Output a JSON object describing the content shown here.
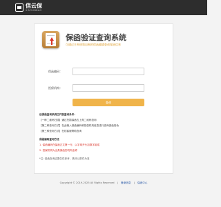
{
  "header": {
    "logo_text": "信云保",
    "logo_subtext": "XINYUNBAO"
  },
  "card": {
    "title": "保函验证查询系统",
    "subtitle": "可通过主系统和自制的保函编辑查询保函信息",
    "fields": [
      {
        "label": "保函编码：",
        "placeholder": ""
      },
      {
        "label": "担保机构：",
        "placeholder": ""
      }
    ],
    "query_button": "查询"
  },
  "help": {
    "title": "信保函查询系统已开放查询条件：",
    "lines": [
      "【一种二维码扫描】通过扫描保函右上角二维码查询",
      "【第二种查询方式】在此输入保函编码和担保机构信息进行查询保函真伪",
      "【第三种查询方式】在线客服帮助查询"
    ],
    "method_title": "保函编码查询方法",
    "method_lines": [
      "1. 保函编码在保函正文第一行，以字母开头加数字组成",
      "2. 担保机构为出具保函的机构全称"
    ],
    "note": "*注: 保函查询结果仅供参考，具体以原件为准"
  },
  "footer": {
    "copyright": "Copyright © 2019-2025  All Rights Reserved",
    "link1": "备案信息",
    "link2": "保函中心"
  },
  "colors": {
    "topbar": "#2d2d2d",
    "accent": "#f0b44a",
    "subtitle": "#e0a43a",
    "warning": "#d9352b",
    "link": "#2b5aa8"
  }
}
